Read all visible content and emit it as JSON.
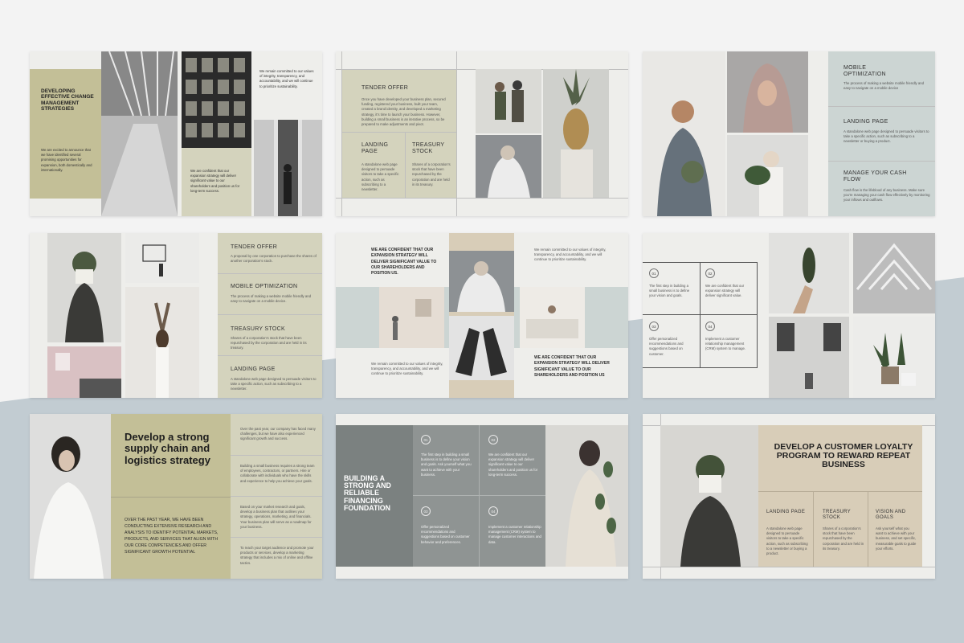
{
  "colors": {
    "background": "#f3f3f3",
    "band": "#c2ccd2",
    "olive": "#c3bf97",
    "sage": "#ccd5d3",
    "beige": "#d8cdb8",
    "slate": "#7b8180"
  },
  "slide1": {
    "title": "DEVELOPING EFFECTIVE CHANGE MANAGEMENT STRATEGIES",
    "body1": "We are excited to announce that we have identified several promising opportunities for expansion, both domestically and internationally.",
    "body2": "We are confident that our expansion strategy will deliver significant value to our shareholders and position us for long-term success.",
    "body3": "We remain committed to our values of integrity, transparency, and accountability, and we will continue to prioritize sustainability."
  },
  "slide2": {
    "title": "TENDER OFFER",
    "body": "Once you have developed your business plan, secured funding, registered your business, built your team, created a brand identity, and developed a marketing strategy, it's time to launch your business. However, building a small business is an iterative process, so be prepared to make adjustments and pivot.",
    "col1_title": "LANDING PAGE",
    "col1_body": "A standalone web page designed to persuade visitors to take a specific action, such as subscribing to a newsletter.",
    "col2_title": "TREASURY STOCK",
    "col2_body": "Shares of a corporation's stock that have been repurchased by the corporation and are held in its treasury."
  },
  "slide3": {
    "items": [
      {
        "title": "MOBILE OPTIMIZATION",
        "body": "The process of making a website mobile friendly and easy to navigate on a mobile device"
      },
      {
        "title": "LANDING PAGE",
        "body": "A standalone web page designed to persuade visitors to take a specific action, such as subscribing to a newsletter or buying a product."
      },
      {
        "title": "MANAGE YOUR CASH FLOW",
        "body": "Cash flow is the lifeblood of any business. Make sure you're managing your cash flow effectively by monitoring your inflows and outflows."
      }
    ]
  },
  "slide4": {
    "items": [
      {
        "title": "TENDER OFFER",
        "body": "A proposal by one corporation to purchase the shares of another corporation's stock."
      },
      {
        "title": "MOBILE OPTIMIZATION",
        "body": "The process of making a website mobile friendly and easy to navigate on a mobile device."
      },
      {
        "title": "TREASURY STOCK",
        "body": "Shares of a corporation's stock that have been repurchased by the corporation and are held in its treasury."
      },
      {
        "title": "LANDING PAGE",
        "body": "A standalone web page designed to persuade visitors to take a specific action, such as subscribing to a newsletter."
      }
    ]
  },
  "slide5": {
    "heading1": "WE ARE CONFIDENT THAT OUR EXPANSION STRATEGY WILL DELIVER SIGNIFICANT VALUE TO OUR SHAREHOLDERS AND POSITION US.",
    "body1": "We remain committed to our values of integrity, transparency, and accountability, and we will continue to prioritize sustainability.",
    "body2": "We remain committed to our values of integrity, transparency, and accountability, and we will continue to prioritize sustainability.",
    "heading2": "WE ARE CONFIDENT THAT OUR EXPANSION STRATEGY WILL DELIVER SIGNIFICANT VALUE TO OUR SHAREHOLDERS AND POSITION US"
  },
  "slide6": {
    "steps": [
      {
        "num": "01",
        "text": "The first step in building a small business is to define your vision and goals."
      },
      {
        "num": "02",
        "text": "We are confident that our expansion strategy will deliver significant value."
      },
      {
        "num": "03",
        "text": "Offer personalized recommendations and suggestions based on customer."
      },
      {
        "num": "04",
        "text": "Implement a customer relationship management (CRM) system to manage."
      }
    ]
  },
  "slide7": {
    "title": "Develop a strong supply chain and logistics strategy",
    "caps": "OVER THE PAST YEAR, WE HAVE BEEN CONDUCTING EXTENSIVE RESEARCH AND ANALYSIS TO IDENTIFY POTENTIAL MARKETS, PRODUCTS, AND SERVICES THAT ALIGN WITH OUR CORE COMPETENCIES AND OFFER SIGNIFICANT GROWTH POTENTIAL",
    "col": [
      "Over the past year, our company has faced many challenges, but we have also experienced significant growth and success.",
      "Building a small business requires a strong team of employees, contractors, or partners. Hire or collaborate with individuals who have the skills and experience to help you achieve your goals.",
      "Based on your market research and goals, develop a business plan that outlines your strategy, operations, marketing, and financials. Your business plan will serve as a roadmap for your business.",
      "To reach your target audience and promote your products or services, develop a marketing strategy that includes a mix of online and offline tactics."
    ]
  },
  "slide8": {
    "title": "BUILDING A STRONG AND RELIABLE FINANCING FOUNDATION",
    "steps": [
      {
        "num": "01",
        "text": "The first step in building a small business is to define your vision and goals. Ask yourself what you want to achieve with your business."
      },
      {
        "num": "02",
        "text": "We are confident that our expansion strategy will deliver significant value to our shareholders and position us for long-term success."
      },
      {
        "num": "03",
        "text": "Offer personalized recommendations and suggestions based on customer behavior and preferences."
      },
      {
        "num": "04",
        "text": "Implement a customer relationship management (CRM) system to manage customer interactions and data."
      }
    ]
  },
  "slide9": {
    "title": "DEVELOP A CUSTOMER LOYALTY PROGRAM TO REWARD REPEAT BUSINESS",
    "cols": [
      {
        "title": "LANDING PAGE",
        "body": "A standalone web page designed to persuade visitors to take a specific action, such as subscribing to a newsletter or buying a product."
      },
      {
        "title": "TREASURY STOCK",
        "body": "Shares of a corporation's stock that have been repurchased by the corporation and are held in its treasury."
      },
      {
        "title": "VISION AND GOALS",
        "body": "Ask yourself what you want to achieve with your business, and set specific, measurable goals to guide your efforts."
      }
    ]
  }
}
